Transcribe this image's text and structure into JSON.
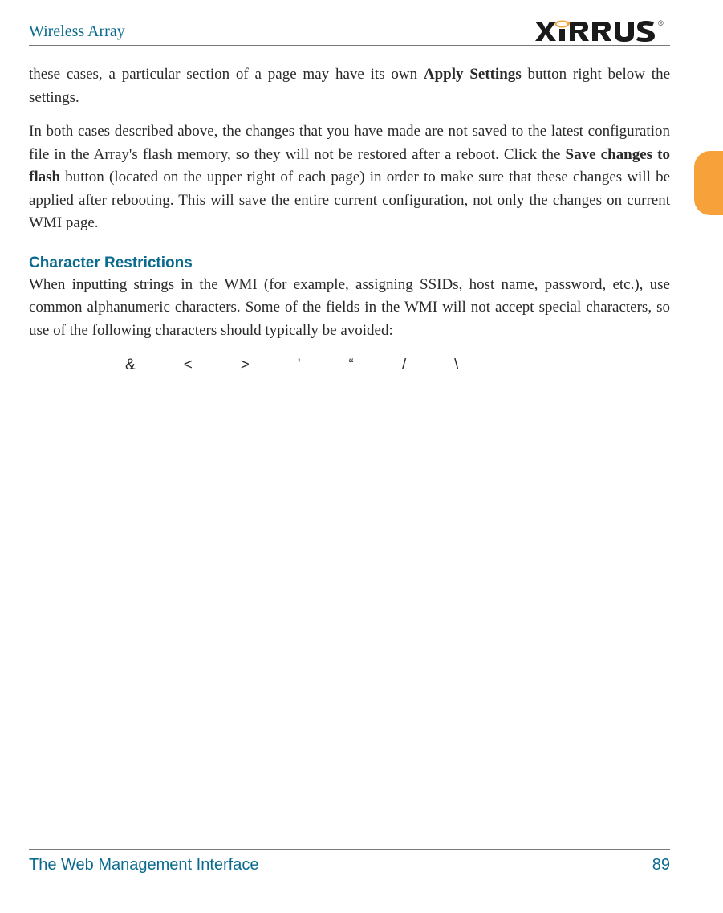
{
  "header": {
    "title": "Wireless Array",
    "logo_text": "XIRRUS",
    "logo_mark": "®"
  },
  "paragraphs": {
    "p1_a": "these cases, a particular section of a page may have its own ",
    "p1_b": "Apply Settings",
    "p1_c": " button right below the settings.",
    "p2_a": "In both cases described above, the changes that you have made are not saved to the latest configuration file in the Array's flash memory, so they will not be restored after a reboot. Click the ",
    "p2_b": "Save changes to flash",
    "p2_c": " button (located on the upper right of each page) in order to make sure that these changes will be applied after rebooting. This will save the entire current configuration, not only the changes on current WMI page."
  },
  "section": {
    "heading": "Character Restrictions",
    "body": "When inputting strings in the WMI (for example, assigning SSIDs, host name, password, etc.), use common alphanumeric characters. Some of the fields in the WMI will not accept special characters, so use of the following characters should typically be avoided:"
  },
  "chars": [
    "&",
    "<",
    ">",
    "'",
    "“",
    "/",
    "\\"
  ],
  "footer": {
    "section": "The Web Management Interface",
    "page": "89"
  }
}
